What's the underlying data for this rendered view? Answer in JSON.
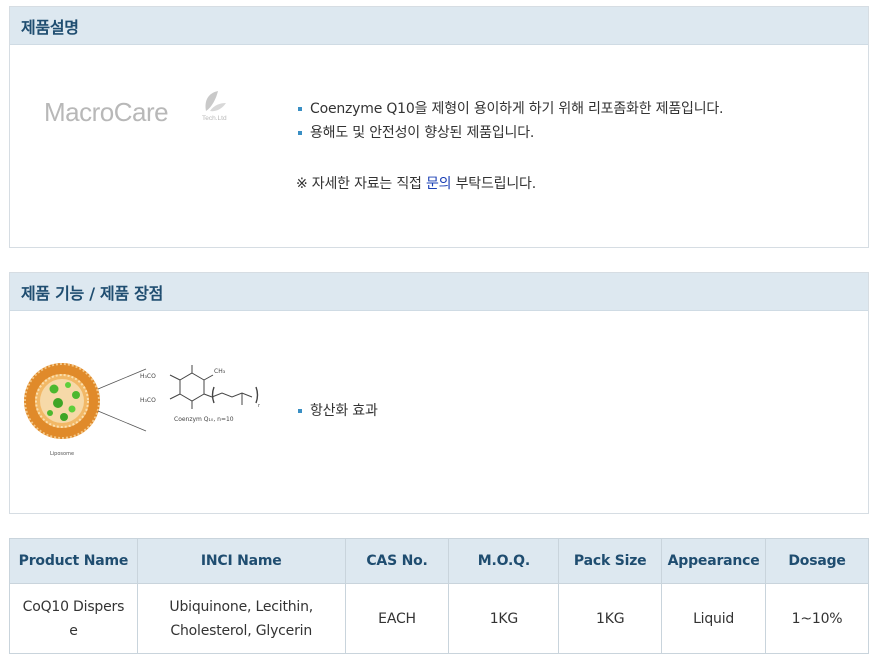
{
  "description": {
    "title": "제품설명",
    "logo_text": "MacroCare",
    "logo_sub": "Tech.Ltd",
    "bullets": [
      "Coenzyme Q10을 제형이 용이하게 하기 위해 리포좀화한 제품입니다.",
      "용해도 및 안전성이 향상된 제품입니다."
    ],
    "note_prefix": "※ 자세한 자료는 직접 ",
    "note_link": "문의",
    "note_suffix": " 부탁드립니다."
  },
  "function": {
    "title": "제품 기능 / 제품 장점",
    "image_labels": {
      "liposome": "Liposome",
      "molecule": "Coenzym Q₁₀, n=10",
      "h3co_top": "H₃CO",
      "h3co_bottom": "H₃CO",
      "ch3": "CH₃",
      "n": "n"
    },
    "bullets": [
      "항산화 효과"
    ]
  },
  "table": {
    "headers": [
      "Product Name",
      "INCI Name",
      "CAS No.",
      "M.O.Q.",
      "Pack Size",
      "Appearance",
      "Dosage"
    ],
    "rows": [
      [
        "CoQ10 Disperse",
        "Ubiquinone, Lecithin, Cholesterol, Glycerin",
        "EACH",
        "1KG",
        "1KG",
        "Liquid",
        "1~10%"
      ]
    ]
  },
  "colors": {
    "header_bg": "#dde8f0",
    "header_text": "#1f4d70",
    "bullet": "#3a8fc4",
    "link": "#1a3fb4",
    "liposome_orange": "#e08a2a",
    "sphere_green": "#4cb82e"
  }
}
